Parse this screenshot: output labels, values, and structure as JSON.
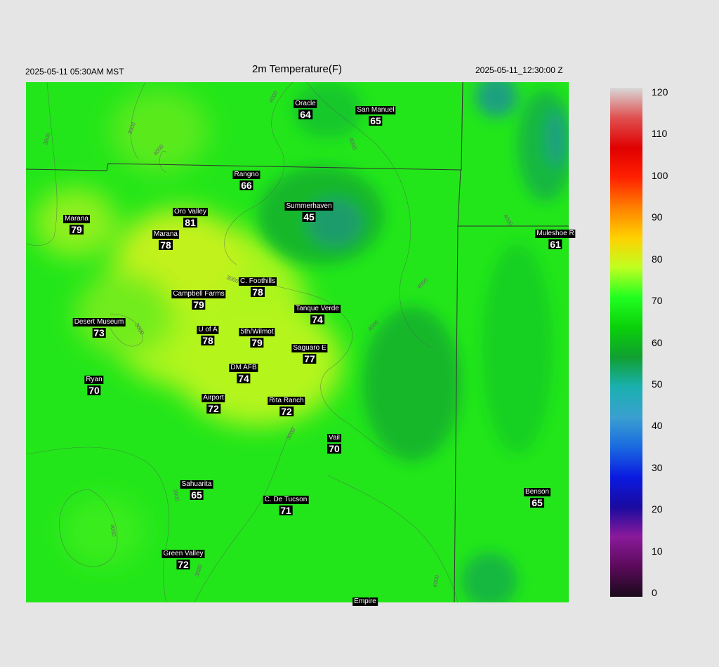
{
  "header": {
    "left_time": "2025-05-11 05:30AM MST",
    "title": "2m Temperature(F)",
    "right_time": "2025-05-11_12:30:00 Z"
  },
  "stations": [
    {
      "name": "Oracle",
      "value": "64"
    },
    {
      "name": "San Manuel",
      "value": "65"
    },
    {
      "name": "Rangno",
      "value": "66"
    },
    {
      "name": "Summerhaven",
      "value": "45"
    },
    {
      "name": "Oro Valley",
      "value": "81"
    },
    {
      "name": "Marana",
      "value": "79"
    },
    {
      "name": "Marana",
      "value": "78"
    },
    {
      "name": "Muleshoe R",
      "value": "61"
    },
    {
      "name": "C. Foothills",
      "value": "78"
    },
    {
      "name": "Campbell Farms",
      "value": "79"
    },
    {
      "name": "Tanque Verde",
      "value": "74"
    },
    {
      "name": "Desert Museum",
      "value": "73"
    },
    {
      "name": "U of A",
      "value": "78"
    },
    {
      "name": "5th/Wilmot",
      "value": "79"
    },
    {
      "name": "Saguaro E",
      "value": "77"
    },
    {
      "name": "DM AFB",
      "value": "74"
    },
    {
      "name": "Ryan",
      "value": "70"
    },
    {
      "name": "Airport",
      "value": "72"
    },
    {
      "name": "Rita Ranch",
      "value": "72"
    },
    {
      "name": "Vail",
      "value": "70"
    },
    {
      "name": "Sahuarita",
      "value": "65"
    },
    {
      "name": "C. De Tucson",
      "value": "71"
    },
    {
      "name": "Benson",
      "value": "65"
    },
    {
      "name": "Green Valley",
      "value": "72"
    },
    {
      "name": "Empire",
      "value": ""
    }
  ],
  "contour_labels": [
    "3000",
    "4000",
    "3000",
    "4000",
    "4000",
    "3000",
    "3000",
    "4000",
    "3000",
    "4000",
    "4000",
    "3000",
    "4000",
    "3000",
    "4000"
  ],
  "colorbar": {
    "ticks": [
      "120",
      "110",
      "100",
      "90",
      "80",
      "70",
      "60",
      "50",
      "40",
      "30",
      "20",
      "10",
      "0"
    ],
    "min": 0,
    "max": 120,
    "colors": [
      "#1a0a1a",
      "#5a0a5a",
      "#8a1a9a",
      "#1a0aa0",
      "#0a1ae0",
      "#1a6ae0",
      "#3aa0d0",
      "#1ab0b0",
      "#10a030",
      "#0ad00a",
      "#20ff20",
      "#c0ff20",
      "#ffd000",
      "#ff8000",
      "#ff2000",
      "#e00000",
      "#e05050",
      "#d8d8d8"
    ]
  }
}
